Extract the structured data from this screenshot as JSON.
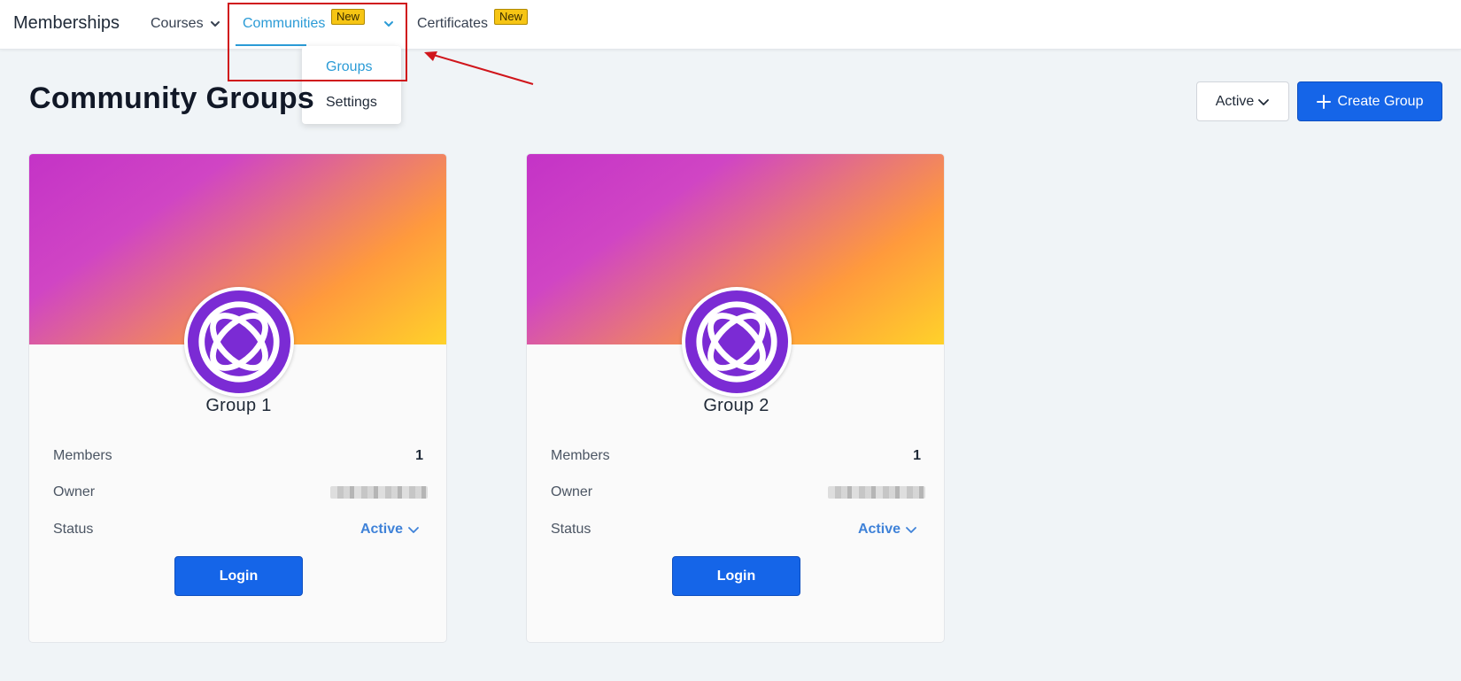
{
  "header": {
    "brand": "Memberships",
    "nav": {
      "courses": "Courses",
      "communities": "Communities",
      "communities_badge": "New",
      "certificates": "Certificates",
      "certificates_badge": "New"
    },
    "dropdown": {
      "items": [
        "Groups",
        "Settings"
      ],
      "active": "Groups"
    }
  },
  "page": {
    "title": "Community Groups",
    "filter_value": "Active",
    "create_label": "Create Group"
  },
  "groups": [
    {
      "name": "Group 1",
      "members_label": "Members",
      "members": "1",
      "owner_label": "Owner",
      "status_label": "Status",
      "status": "Active",
      "login_label": "Login"
    },
    {
      "name": "Group 2",
      "members_label": "Members",
      "members": "1",
      "owner_label": "Owner",
      "status_label": "Status",
      "status": "Active",
      "login_label": "Login"
    }
  ],
  "colors": {
    "accent": "#2b9bd6",
    "primary_button": "#1565e8",
    "badge": "#f6c514",
    "annotation": "#d0151b",
    "avatar": "#7b2bd4"
  },
  "icons": [
    "chevron-down-icon",
    "plus-icon",
    "community-logo-icon",
    "annotation-arrow"
  ]
}
